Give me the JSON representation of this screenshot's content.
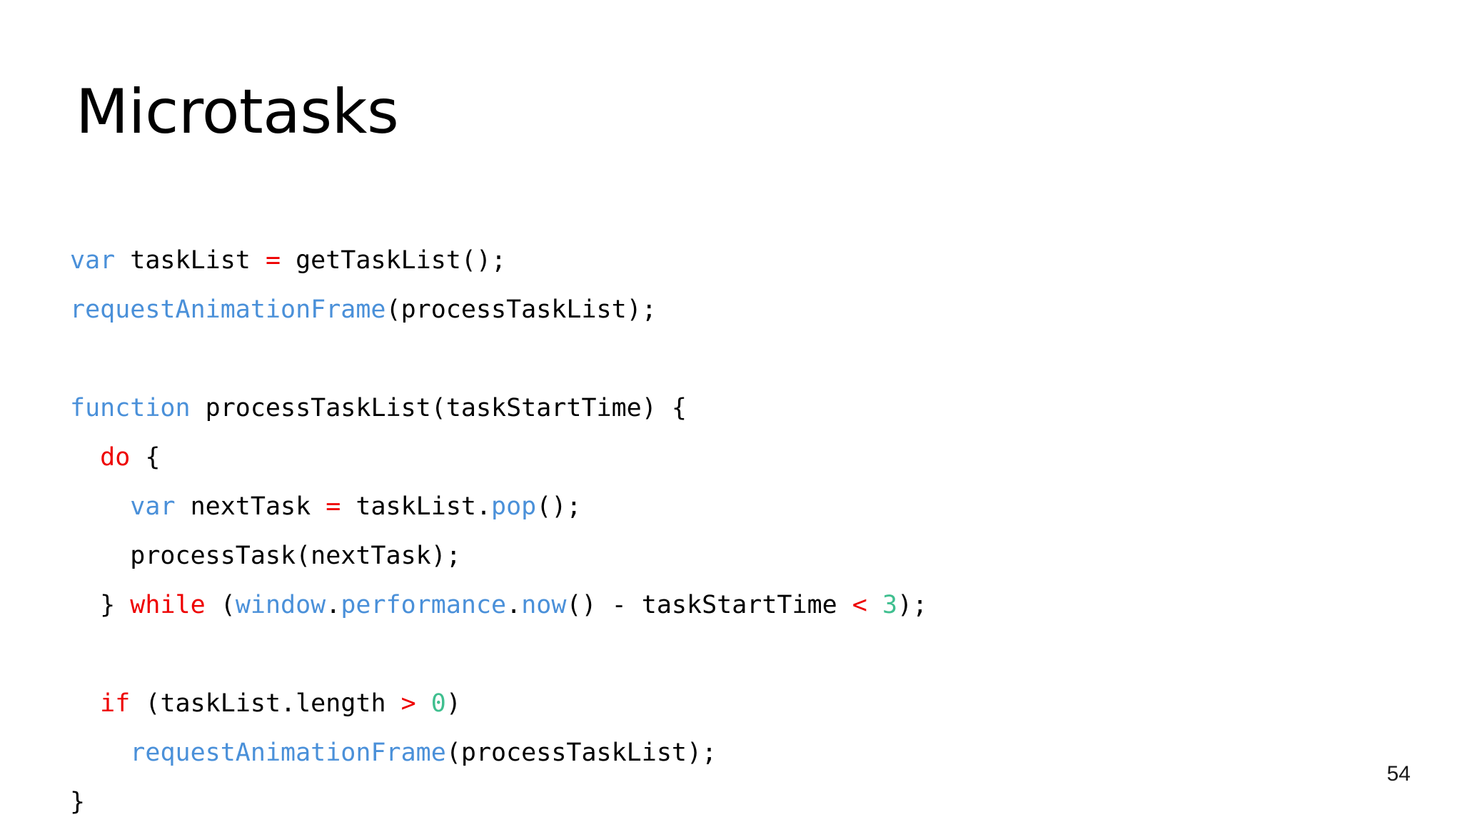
{
  "slide": {
    "title": "Microtasks",
    "page_number": "54",
    "background_color": "#ffffff"
  },
  "colors": {
    "keyword_blue": "#4a90d9",
    "keyword_red": "#ee0000",
    "number_green": "#3fbf8f",
    "plain_text": "#000000"
  },
  "code": {
    "language": "javascript",
    "lines": [
      {
        "index": 0,
        "text": "var taskList = getTaskList();",
        "tokens": [
          {
            "t": "var",
            "c": "kw-blue"
          },
          {
            "t": " taskList ",
            "c": "plain"
          },
          {
            "t": "=",
            "c": "op-red"
          },
          {
            "t": " getTaskList();",
            "c": "plain"
          }
        ]
      },
      {
        "index": 1,
        "text": "requestAnimationFrame(processTaskList);",
        "tokens": [
          {
            "t": "requestAnimationFrame",
            "c": "fn-blue"
          },
          {
            "t": "(processTaskList);",
            "c": "plain"
          }
        ]
      },
      {
        "index": 2,
        "text": "",
        "tokens": []
      },
      {
        "index": 3,
        "text": "function processTaskList(taskStartTime) {",
        "tokens": [
          {
            "t": "function",
            "c": "kw-blue"
          },
          {
            "t": " processTaskList(taskStartTime) {",
            "c": "plain"
          }
        ]
      },
      {
        "index": 4,
        "text": "  do {",
        "tokens": [
          {
            "t": "  ",
            "c": "plain"
          },
          {
            "t": "do",
            "c": "red"
          },
          {
            "t": " {",
            "c": "plain"
          }
        ]
      },
      {
        "index": 5,
        "text": "    var nextTask = taskList.pop();",
        "tokens": [
          {
            "t": "    ",
            "c": "plain"
          },
          {
            "t": "var",
            "c": "kw-blue"
          },
          {
            "t": " nextTask ",
            "c": "plain"
          },
          {
            "t": "=",
            "c": "op-red"
          },
          {
            "t": " taskList.",
            "c": "plain"
          },
          {
            "t": "pop",
            "c": "prop-blue"
          },
          {
            "t": "();",
            "c": "plain"
          }
        ]
      },
      {
        "index": 6,
        "text": "    processTask(nextTask);",
        "tokens": [
          {
            "t": "    processTask(nextTask);",
            "c": "plain"
          }
        ]
      },
      {
        "index": 7,
        "text": "  } while (window.performance.now() - taskStartTime < 3);",
        "tokens": [
          {
            "t": "  } ",
            "c": "plain"
          },
          {
            "t": "while",
            "c": "red"
          },
          {
            "t": " (",
            "c": "plain"
          },
          {
            "t": "window",
            "c": "prop-blue"
          },
          {
            "t": ".",
            "c": "plain"
          },
          {
            "t": "performance",
            "c": "prop-blue"
          },
          {
            "t": ".",
            "c": "plain"
          },
          {
            "t": "now",
            "c": "prop-blue"
          },
          {
            "t": "() - taskStartTime ",
            "c": "plain"
          },
          {
            "t": "<",
            "c": "op-red"
          },
          {
            "t": " ",
            "c": "plain"
          },
          {
            "t": "3",
            "c": "num-green"
          },
          {
            "t": ");",
            "c": "plain"
          }
        ]
      },
      {
        "index": 8,
        "text": "",
        "tokens": []
      },
      {
        "index": 9,
        "text": "  if (taskList.length > 0)",
        "tokens": [
          {
            "t": "  ",
            "c": "plain"
          },
          {
            "t": "if",
            "c": "red"
          },
          {
            "t": " (taskList.length ",
            "c": "plain"
          },
          {
            "t": ">",
            "c": "op-red"
          },
          {
            "t": " ",
            "c": "plain"
          },
          {
            "t": "0",
            "c": "num-green"
          },
          {
            "t": ")",
            "c": "plain"
          }
        ]
      },
      {
        "index": 10,
        "text": "    requestAnimationFrame(processTaskList);",
        "tokens": [
          {
            "t": "    ",
            "c": "plain"
          },
          {
            "t": "requestAnimationFrame",
            "c": "fn-blue"
          },
          {
            "t": "(processTaskList);",
            "c": "plain"
          }
        ]
      },
      {
        "index": 11,
        "text": "}",
        "tokens": [
          {
            "t": "}",
            "c": "plain"
          }
        ]
      }
    ]
  }
}
